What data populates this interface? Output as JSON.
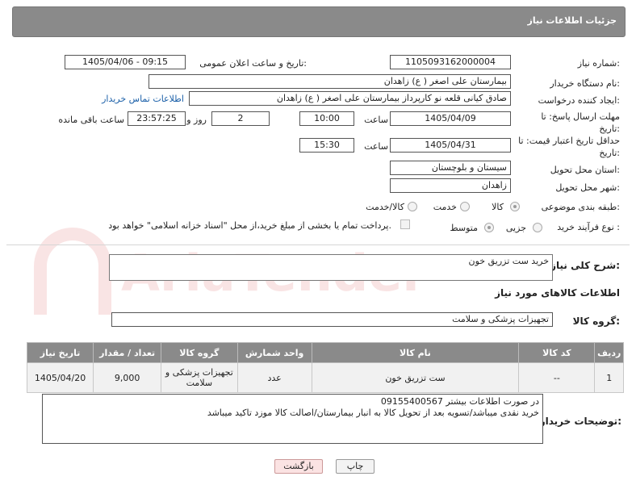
{
  "header": {
    "title": "جزئیات اطلاعات نیاز"
  },
  "form": {
    "need_number": {
      "label": "شماره نیاز:",
      "value": "1105093162000004"
    },
    "announce": {
      "label": "تاریخ و ساعت اعلان عمومی:",
      "value": "1405/04/06 - 09:15"
    },
    "buyer_org": {
      "label": "نام دستگاه خریدار:",
      "value": "بیمارستان علی اصغر ( ع) زاهدان"
    },
    "requester": {
      "label": "ایجاد کننده درخواست:",
      "value": "صادق کیانی قلعه نو کارپرداز بیمارستان علی اصغر ( ع) زاهدان",
      "contact_link": "اطلاعات تماس خریدار"
    },
    "reply_deadline": {
      "label": "مهلت ارسال پاسخ: تا تاریخ:",
      "date": "1405/04/09",
      "time_label": "ساعت",
      "time": "10:00",
      "days": "2",
      "days_label": "روز و",
      "remaining": "23:57:25",
      "remaining_label": "ساعت باقی مانده"
    },
    "price_validity": {
      "label": "حداقل تاریخ اعتبار قیمت: تا تاریخ:",
      "date": "1405/04/31",
      "time_label": "ساعت",
      "time": "15:30"
    },
    "province": {
      "label": "استان محل تحویل:",
      "value": "سیستان و بلوچستان"
    },
    "city": {
      "label": "شهر محل تحویل:",
      "value": "زاهدان"
    },
    "category": {
      "label": "طبقه بندی موضوعی:",
      "options": [
        "کالا",
        "خدمت",
        "کالا/خدمت"
      ],
      "selected": "کالا"
    },
    "process": {
      "label": "نوع فرآیند خرید :",
      "options": [
        "جزیی",
        "متوسط"
      ],
      "selected": "متوسط",
      "note": "پرداخت تمام یا بخشی از مبلغ خرید،از محل \"اسناد خزانه اسلامی\" خواهد بود."
    }
  },
  "summary": {
    "label": "شرح کلی نیاز:",
    "value": "خرید ست تزریق خون"
  },
  "goods_section": {
    "title": "اطلاعات کالاهای مورد نیاز",
    "group_label": "گروه کالا:",
    "group_value": "تجهیزات پزشکی و سلامت"
  },
  "table": {
    "headers": [
      "ردیف",
      "کد کالا",
      "نام کالا",
      "واحد شمارش",
      "گروه کالا",
      "تعداد / مقدار",
      "تاریخ نیاز"
    ],
    "rows": [
      [
        "1",
        "--",
        "ست تزریق خون",
        "عدد",
        "تجهیزات پزشکی و سلامت",
        "9,000",
        "1405/04/20"
      ]
    ]
  },
  "buyer_notes": {
    "label": "توضیحات خریدار:",
    "line1": "در صورت اطلاعات بیشتر 09155400567",
    "line2": "خرید نقدی میباشد/تسویه بعد از تحویل کالا به انبار بیمارستان/اصالت کالا موزد تاکید میباشد"
  },
  "buttons": {
    "print": "چاپ",
    "back": "بازگشت"
  },
  "watermark": "AriaTender.net"
}
